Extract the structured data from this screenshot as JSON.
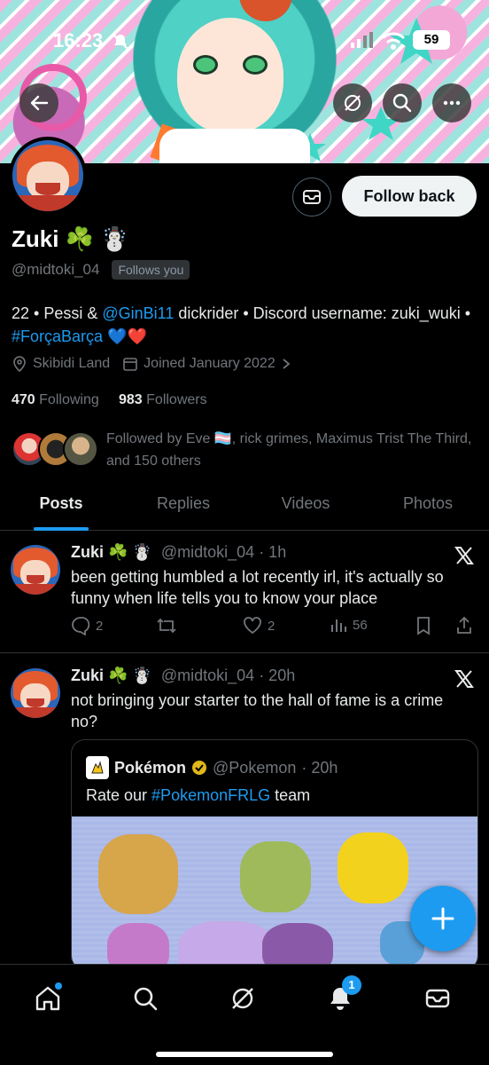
{
  "status_bar": {
    "time": "16:23",
    "battery": "59"
  },
  "profile": {
    "display_name": "Zuki ☘️ ☃️",
    "handle": "@midtoki_04",
    "follows_you_badge": "Follows you",
    "bio": {
      "part1": "22 • Pessi & ",
      "mention": "@GinBi11",
      "part2": " dickrider • Discord username: zuki_wuki • ",
      "hashtag": "#ForçaBarça",
      "emoji": " 💙❤️"
    },
    "location": "Skibidi Land",
    "joined": "Joined January 2022",
    "following_count": "470",
    "following_label": "Following",
    "followers_count": "983",
    "followers_label": "Followers",
    "followed_by": "Followed by Eve 🏳️‍⚧️, rick grimes, Maximus Trist The Third, and 150 others",
    "follow_button": "Follow back"
  },
  "tabs": [
    {
      "label": "Posts",
      "active": true
    },
    {
      "label": "Replies",
      "active": false
    },
    {
      "label": "Videos",
      "active": false
    },
    {
      "label": "Photos",
      "active": false
    }
  ],
  "tweets": [
    {
      "name": "Zuki ☘️ ☃️",
      "handle": "@midtoki_04",
      "time": "· 1h",
      "text": "been getting humbled a lot recently irl, it's actually so funny when life tells you to know your place",
      "replies": "2",
      "retweets": "",
      "likes": "2",
      "views": "56"
    },
    {
      "name": "Zuki ☘️ ☃️",
      "handle": "@midtoki_04",
      "time": "· 20h",
      "text": "not bringing your starter to the hall of fame is a crime no?",
      "quote": {
        "name": "Pokémon",
        "handle": "@Pokemon",
        "time": "· 20h",
        "text_prefix": "Rate our ",
        "hashtag": "#PokemonFRLG",
        "text_suffix": " team"
      }
    }
  ],
  "nav": {
    "notifications_badge": "1"
  },
  "colors": {
    "accent": "#1d9bf0",
    "background": "#000000",
    "muted": "#71767b"
  }
}
